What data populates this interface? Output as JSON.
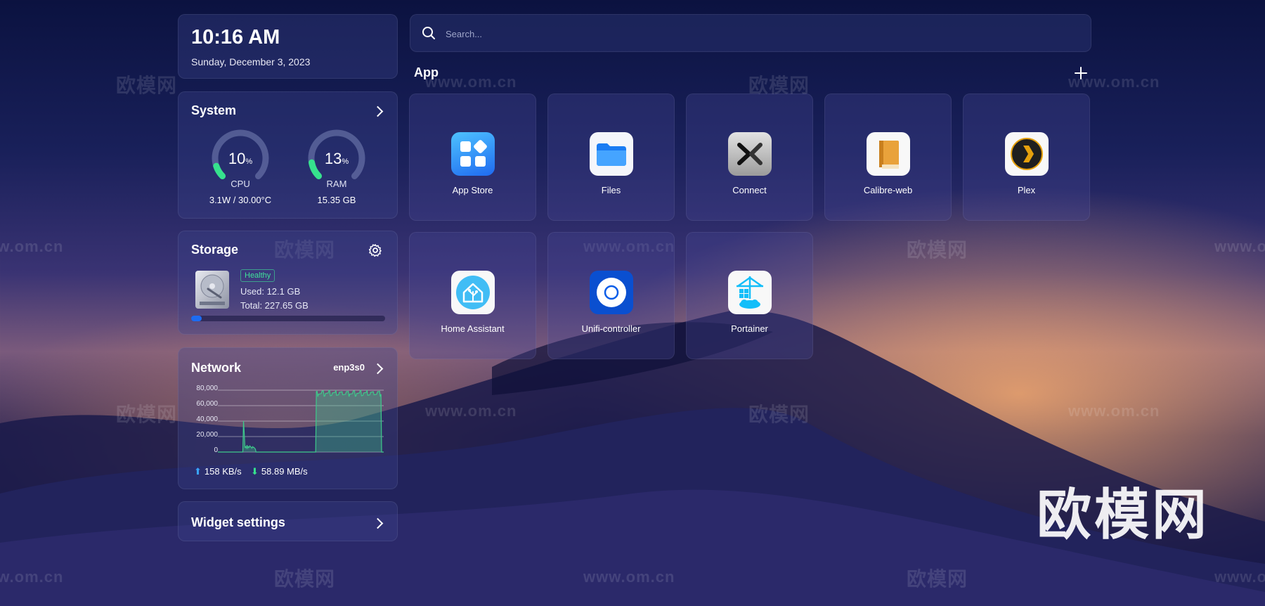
{
  "clock": {
    "time": "10:16 AM",
    "date": "Sunday, December 3, 2023"
  },
  "system": {
    "title": "System",
    "cpu": {
      "value": "10",
      "unit": "%",
      "label": "CPU",
      "detail": "3.1W / 30.00°C",
      "fraction": 0.1
    },
    "ram": {
      "value": "13",
      "unit": "%",
      "label": "RAM",
      "detail": "15.35 GB",
      "fraction": 0.13
    },
    "accent": "#36e28d"
  },
  "storage": {
    "title": "Storage",
    "status": "Healthy",
    "used": "Used: 12.1 GB",
    "total": "Total: 227.65 GB",
    "usage_fraction": 0.053
  },
  "network": {
    "title": "Network",
    "interface": "enp3s0",
    "upload": "158 KB/s",
    "download": "58.89 MB/s",
    "chart_data": {
      "type": "area",
      "y_ticks": [
        "80,000",
        "60,000",
        "40,000",
        "20,000",
        "0"
      ],
      "ylim": [
        0,
        80000
      ],
      "values": [
        0,
        0,
        0,
        0,
        0,
        0,
        0,
        0,
        0,
        0,
        0,
        0,
        0,
        0,
        0,
        0,
        0,
        0,
        0,
        0,
        0,
        0,
        0,
        0,
        0,
        0,
        0,
        0,
        0,
        0,
        0,
        0,
        0,
        0,
        0,
        0,
        0,
        40000,
        25000,
        6000,
        7000,
        5000,
        9000,
        5000,
        7000,
        6000,
        8000,
        7000,
        6000,
        5000,
        7000,
        6000,
        6000,
        5000,
        4000,
        0,
        0,
        0,
        0,
        0,
        0,
        0,
        0,
        0,
        0,
        0,
        0,
        0,
        0,
        0,
        0,
        0,
        0,
        0,
        0,
        0,
        0,
        0,
        0,
        0,
        0,
        0,
        0,
        0,
        0,
        0,
        0,
        0,
        0,
        0,
        0,
        0,
        0,
        0,
        0,
        0,
        0,
        0,
        0,
        0,
        0,
        0,
        0,
        0,
        0,
        0,
        0,
        0,
        0,
        0,
        0,
        0,
        0,
        0,
        0,
        0,
        0,
        0,
        0,
        0,
        0,
        0,
        0,
        0,
        0,
        0,
        0,
        0,
        0,
        0,
        0,
        0,
        0,
        0,
        0,
        0,
        0,
        0,
        0,
        0,
        0,
        0,
        0,
        0,
        0,
        0,
        0,
        0,
        0,
        0,
        0,
        0,
        0,
        0,
        0,
        0,
        0,
        0,
        0,
        0,
        0,
        0,
        0,
        0,
        0,
        0,
        0,
        0,
        0,
        0,
        0,
        0,
        0,
        0,
        0,
        0,
        0,
        0,
        0,
        0,
        0,
        0,
        0,
        0,
        0,
        0,
        0,
        0,
        0,
        0,
        0,
        0,
        0,
        0,
        0,
        0,
        0,
        0,
        0,
        0,
        0,
        0,
        0,
        0,
        0,
        0,
        0,
        0,
        0,
        0,
        0,
        0,
        0,
        0,
        0,
        0,
        0,
        0,
        0,
        0,
        0,
        0,
        0,
        0,
        0,
        0,
        0,
        0,
        0,
        0,
        0,
        0,
        0,
        0,
        0,
        0,
        0,
        0,
        0,
        0,
        0,
        0,
        0,
        0,
        0,
        0
      ],
      "series_color": "#3ec98b"
    }
  },
  "widget_settings": {
    "label": "Widget settings"
  },
  "search": {
    "placeholder": "Search..."
  },
  "apps": {
    "heading": "App",
    "items": [
      {
        "label": "App Store",
        "icon": "app-store-icon"
      },
      {
        "label": "Files",
        "icon": "files-icon"
      },
      {
        "label": "Connect",
        "icon": "connect-icon"
      },
      {
        "label": "Calibre-web",
        "icon": "calibre-icon"
      },
      {
        "label": "Plex",
        "icon": "plex-icon"
      },
      {
        "label": "Home Assistant",
        "icon": "home-assistant-icon"
      },
      {
        "label": "Unifi-controller",
        "icon": "unifi-icon"
      },
      {
        "label": "Portainer",
        "icon": "portainer-icon"
      }
    ]
  },
  "watermark": {
    "brand": "欧模网",
    "site": "www.om.cn"
  }
}
